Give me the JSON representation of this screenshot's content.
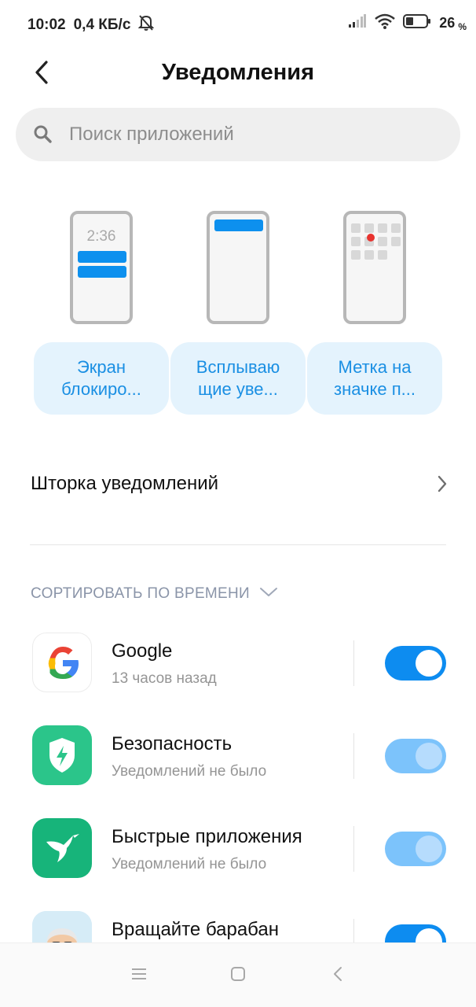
{
  "status_bar": {
    "time": "10:02",
    "speed": "0,4 КБ/с",
    "battery_level": "26",
    "battery_unit": "%"
  },
  "header": {
    "title": "Уведомления"
  },
  "search": {
    "placeholder": "Поиск приложений"
  },
  "lock_preview_time": "2:36",
  "notification_types": [
    {
      "label": "Экран блокиро..."
    },
    {
      "label": "Всплываю щие уве..."
    },
    {
      "label": "Метка на значке п..."
    }
  ],
  "notification_shade": {
    "label": "Шторка уведомлений"
  },
  "sort": {
    "label": "СОРТИРОВАТЬ ПО ВРЕМЕНИ"
  },
  "apps": [
    {
      "name": "Google",
      "subtitle": "13 часов назад",
      "enabled": true
    },
    {
      "name": "Безопасность",
      "subtitle": "Уведомлений не было",
      "enabled": true
    },
    {
      "name": "Быстрые приложения",
      "subtitle": "Уведомлений не было",
      "enabled": true
    },
    {
      "name": "Вращайте барабан",
      "subtitle": "",
      "enabled": true
    }
  ],
  "colors": {
    "accent": "#0d8cf0",
    "accent_light": "#7cc3fb",
    "chip_bg": "#e4f3fd",
    "chip_text": "#1a8fe3",
    "security_green": "#2bc58a",
    "quickapps_green": "#17b47a"
  },
  "nav": {
    "icons": [
      "menu-icon",
      "home-icon",
      "back-icon"
    ]
  }
}
